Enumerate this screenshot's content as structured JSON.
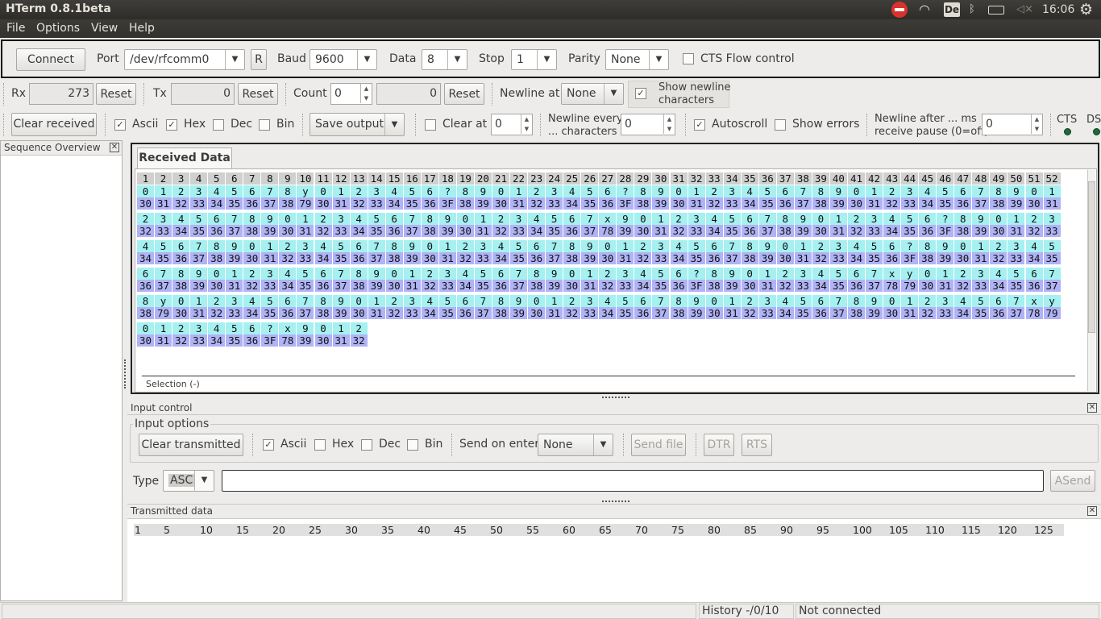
{
  "topbar": {
    "title": "HTerm 0.8.1beta",
    "keyboard": "De",
    "time": "16:06"
  },
  "menu": [
    "File",
    "Options",
    "View",
    "Help"
  ],
  "connection": {
    "connect_label": "Connect",
    "port_label": "Port",
    "port_value": "/dev/rfcomm0",
    "r_label": "R",
    "baud_label": "Baud",
    "baud_value": "9600",
    "data_label": "Data",
    "data_value": "8",
    "stop_label": "Stop",
    "stop_value": "1",
    "parity_label": "Parity",
    "parity_value": "None",
    "cts_label": "CTS Flow control"
  },
  "counters": {
    "rx_label": "Rx",
    "rx_value": "273",
    "reset1": "Reset",
    "tx_label": "Tx",
    "tx_value": "0",
    "reset2": "Reset",
    "count_label": "Count",
    "count_value": "0",
    "count_ro": "0",
    "reset3": "Reset",
    "newline_label": "Newline at",
    "newline_value": "None",
    "show_newline_line1": "Show newline",
    "show_newline_line2": "characters"
  },
  "display": {
    "clear_received": "Clear received",
    "ascii": "Ascii",
    "hex": "Hex",
    "dec": "Dec",
    "bin": "Bin",
    "save_output": "Save output",
    "clear_at": "Clear at",
    "clear_at_value": "0",
    "newline_every_line1": "Newline every",
    "newline_every_line2": "... characters",
    "newline_every_value": "0",
    "autoscroll": "Autoscroll",
    "show_errors": "Show errors",
    "newline_after_line1": "Newline after ... ms",
    "newline_after_line2": "receive pause (0=off)",
    "newline_after_value": "0",
    "cts": "CTS",
    "dsr": "DS"
  },
  "sequence_overview": {
    "title": "Sequence Overview"
  },
  "received": {
    "tab": "Received Data",
    "selection": "Selection (-)",
    "rows": [
      {
        "ascii": [
          "0",
          "1",
          "2",
          "3",
          "4",
          "5",
          "6",
          "7",
          "8",
          "y",
          "0",
          "1",
          "2",
          "3",
          "4",
          "5",
          "6",
          "?",
          "8",
          "9",
          "0",
          "1",
          "2",
          "3",
          "4",
          "5",
          "6",
          "?",
          "8",
          "9",
          "0",
          "1",
          "2",
          "3",
          "4",
          "5",
          "6",
          "7",
          "8",
          "9",
          "0",
          "1",
          "2",
          "3",
          "4",
          "5",
          "6",
          "7",
          "8",
          "9",
          "0",
          "1"
        ],
        "hex": [
          "30",
          "31",
          "32",
          "33",
          "34",
          "35",
          "36",
          "37",
          "38",
          "79",
          "30",
          "31",
          "32",
          "33",
          "34",
          "35",
          "36",
          "3F",
          "38",
          "39",
          "30",
          "31",
          "32",
          "33",
          "34",
          "35",
          "36",
          "3F",
          "38",
          "39",
          "30",
          "31",
          "32",
          "33",
          "34",
          "35",
          "36",
          "37",
          "38",
          "39",
          "30",
          "31",
          "32",
          "33",
          "34",
          "35",
          "36",
          "37",
          "38",
          "39",
          "30",
          "31"
        ]
      },
      {
        "ascii": [
          "2",
          "3",
          "4",
          "5",
          "6",
          "7",
          "8",
          "9",
          "0",
          "1",
          "2",
          "3",
          "4",
          "5",
          "6",
          "7",
          "8",
          "9",
          "0",
          "1",
          "2",
          "3",
          "4",
          "5",
          "6",
          "7",
          "x",
          "9",
          "0",
          "1",
          "2",
          "3",
          "4",
          "5",
          "6",
          "7",
          "8",
          "9",
          "0",
          "1",
          "2",
          "3",
          "4",
          "5",
          "6",
          "?",
          "8",
          "9",
          "0",
          "1",
          "2",
          "3"
        ],
        "hex": [
          "32",
          "33",
          "34",
          "35",
          "36",
          "37",
          "38",
          "39",
          "30",
          "31",
          "32",
          "33",
          "34",
          "35",
          "36",
          "37",
          "38",
          "39",
          "30",
          "31",
          "32",
          "33",
          "34",
          "35",
          "36",
          "37",
          "78",
          "39",
          "30",
          "31",
          "32",
          "33",
          "34",
          "35",
          "36",
          "37",
          "38",
          "39",
          "30",
          "31",
          "32",
          "33",
          "34",
          "35",
          "36",
          "3F",
          "38",
          "39",
          "30",
          "31",
          "32",
          "33"
        ]
      },
      {
        "ascii": [
          "4",
          "5",
          "6",
          "7",
          "8",
          "9",
          "0",
          "1",
          "2",
          "3",
          "4",
          "5",
          "6",
          "7",
          "8",
          "9",
          "0",
          "1",
          "2",
          "3",
          "4",
          "5",
          "6",
          "7",
          "8",
          "9",
          "0",
          "1",
          "2",
          "3",
          "4",
          "5",
          "6",
          "7",
          "8",
          "9",
          "0",
          "1",
          "2",
          "3",
          "4",
          "5",
          "6",
          "?",
          "8",
          "9",
          "0",
          "1",
          "2",
          "3",
          "4",
          "5"
        ],
        "hex": [
          "34",
          "35",
          "36",
          "37",
          "38",
          "39",
          "30",
          "31",
          "32",
          "33",
          "34",
          "35",
          "36",
          "37",
          "38",
          "39",
          "30",
          "31",
          "32",
          "33",
          "34",
          "35",
          "36",
          "37",
          "38",
          "39",
          "30",
          "31",
          "32",
          "33",
          "34",
          "35",
          "36",
          "37",
          "38",
          "39",
          "30",
          "31",
          "32",
          "33",
          "34",
          "35",
          "36",
          "3F",
          "38",
          "39",
          "30",
          "31",
          "32",
          "33",
          "34",
          "35"
        ]
      },
      {
        "ascii": [
          "6",
          "7",
          "8",
          "9",
          "0",
          "1",
          "2",
          "3",
          "4",
          "5",
          "6",
          "7",
          "8",
          "9",
          "0",
          "1",
          "2",
          "3",
          "4",
          "5",
          "6",
          "7",
          "8",
          "9",
          "0",
          "1",
          "2",
          "3",
          "4",
          "5",
          "6",
          "?",
          "8",
          "9",
          "0",
          "1",
          "2",
          "3",
          "4",
          "5",
          "6",
          "7",
          "x",
          "y",
          "0",
          "1",
          "2",
          "3",
          "4",
          "5",
          "6",
          "7"
        ],
        "hex": [
          "36",
          "37",
          "38",
          "39",
          "30",
          "31",
          "32",
          "33",
          "34",
          "35",
          "36",
          "37",
          "38",
          "39",
          "30",
          "31",
          "32",
          "33",
          "34",
          "35",
          "36",
          "37",
          "38",
          "39",
          "30",
          "31",
          "32",
          "33",
          "34",
          "35",
          "36",
          "3F",
          "38",
          "39",
          "30",
          "31",
          "32",
          "33",
          "34",
          "35",
          "36",
          "37",
          "78",
          "79",
          "30",
          "31",
          "32",
          "33",
          "34",
          "35",
          "36",
          "37"
        ]
      },
      {
        "ascii": [
          "8",
          "y",
          "0",
          "1",
          "2",
          "3",
          "4",
          "5",
          "6",
          "7",
          "8",
          "9",
          "0",
          "1",
          "2",
          "3",
          "4",
          "5",
          "6",
          "7",
          "8",
          "9",
          "0",
          "1",
          "2",
          "3",
          "4",
          "5",
          "6",
          "7",
          "8",
          "9",
          "0",
          "1",
          "2",
          "3",
          "4",
          "5",
          "6",
          "7",
          "8",
          "9",
          "0",
          "1",
          "2",
          "3",
          "4",
          "5",
          "6",
          "7",
          "x",
          "y"
        ],
        "hex": [
          "38",
          "79",
          "30",
          "31",
          "32",
          "33",
          "34",
          "35",
          "36",
          "37",
          "38",
          "39",
          "30",
          "31",
          "32",
          "33",
          "34",
          "35",
          "36",
          "37",
          "38",
          "39",
          "30",
          "31",
          "32",
          "33",
          "34",
          "35",
          "36",
          "37",
          "38",
          "39",
          "30",
          "31",
          "32",
          "33",
          "34",
          "35",
          "36",
          "37",
          "38",
          "39",
          "30",
          "31",
          "32",
          "33",
          "34",
          "35",
          "36",
          "37",
          "78",
          "79"
        ]
      },
      {
        "ascii": [
          "0",
          "1",
          "2",
          "3",
          "4",
          "5",
          "6",
          "?",
          "x",
          "9",
          "0",
          "1",
          "2"
        ],
        "hex": [
          "30",
          "31",
          "32",
          "33",
          "34",
          "35",
          "36",
          "3F",
          "78",
          "39",
          "30",
          "31",
          "32"
        ]
      }
    ]
  },
  "input_control": {
    "title": "Input control",
    "options_title": "Input options",
    "clear_transmitted": "Clear transmitted",
    "ascii": "Ascii",
    "hex": "Hex",
    "dec": "Dec",
    "bin": "Bin",
    "send_on_enter": "Send on enter",
    "send_on_enter_value": "None",
    "send_file": "Send file",
    "dtr": "DTR",
    "rts": "RTS",
    "type_label": "Type",
    "type_value": "ASC",
    "input_value": "",
    "asend": "ASend"
  },
  "transmitted": {
    "title": "Transmitted data",
    "ticks": [
      "1",
      "5",
      "10",
      "15",
      "20",
      "25",
      "30",
      "35",
      "40",
      "45",
      "50",
      "55",
      "60",
      "65",
      "70",
      "75",
      "80",
      "85",
      "90",
      "95",
      "100",
      "105",
      "110",
      "115",
      "120",
      "125"
    ]
  },
  "statusbar": {
    "history": "History -/0/10",
    "connection": "Not connected"
  }
}
